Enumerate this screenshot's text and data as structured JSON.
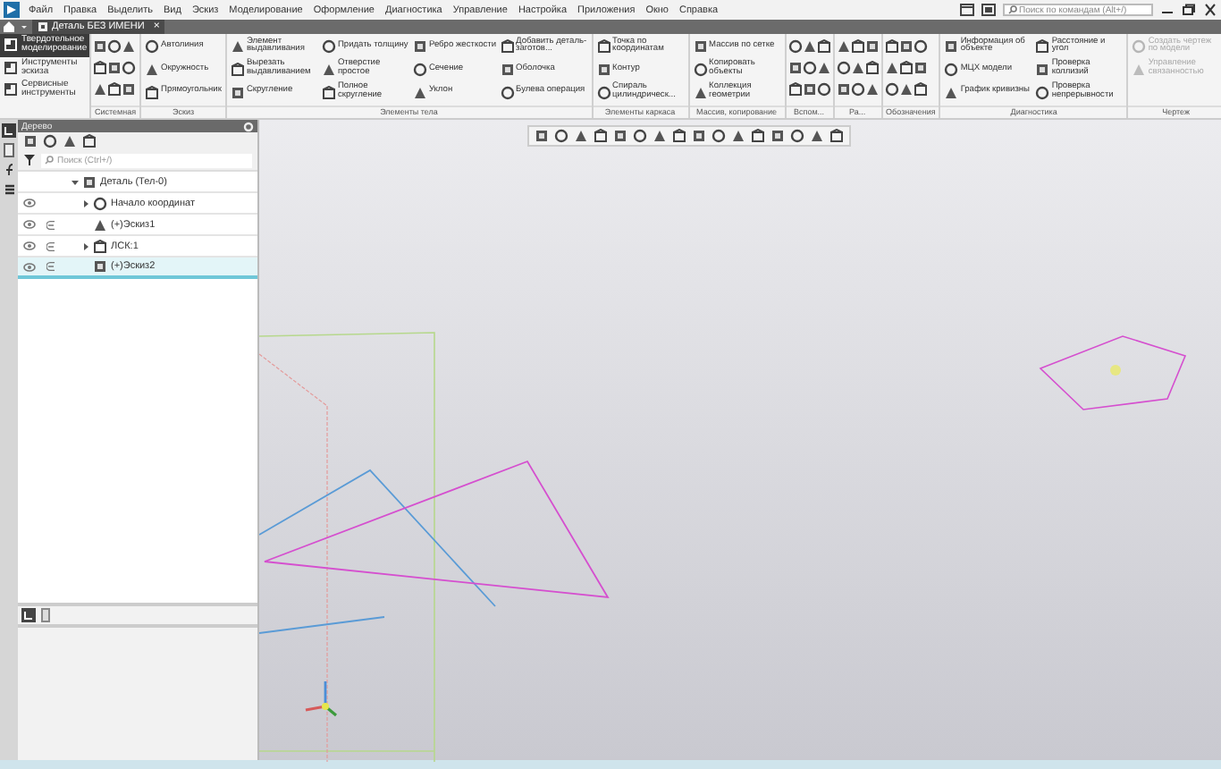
{
  "menu": {
    "items": [
      "Файл",
      "Правка",
      "Выделить",
      "Вид",
      "Эскиз",
      "Моделирование",
      "Оформление",
      "Диагностика",
      "Управление",
      "Настройка",
      "Приложения",
      "Окно",
      "Справка"
    ]
  },
  "command_search": {
    "placeholder": "Поиск по командам (Alt+/)"
  },
  "document_tabs": [
    {
      "label": "Деталь БЕЗ ИМЕНИ",
      "selected": true,
      "close": "×"
    }
  ],
  "ribbon": {
    "modes": [
      {
        "label": "Твердотельное моделирование",
        "selected": true
      },
      {
        "label": "Инструменты эскиза",
        "selected": false
      },
      {
        "label": "Сервисные инструменты",
        "selected": false
      }
    ],
    "groups": [
      {
        "label": "Системная",
        "kind": "icons"
      },
      {
        "label": "Эскиз",
        "kind": "tools",
        "items": [
          {
            "label": "Автолиния",
            "disabled": false
          },
          {
            "label": "Окружность",
            "disabled": false
          },
          {
            "label": "Прямоугольник",
            "disabled": false
          }
        ]
      },
      {
        "label": "Элементы тела",
        "kind": "tools",
        "items": [
          {
            "label": "Элемент выдавливания",
            "disabled": false
          },
          {
            "label": "Вырезать выдавливанием",
            "disabled": false
          },
          {
            "label": "Скругление",
            "disabled": false
          },
          {
            "label": "Придать толщину",
            "disabled": false
          },
          {
            "label": "Отверстие простое",
            "disabled": false
          },
          {
            "label": "Полное скругление",
            "disabled": false
          },
          {
            "label": "Ребро жесткости",
            "disabled": false
          },
          {
            "label": "Сечение",
            "disabled": false
          },
          {
            "label": "Уклон",
            "disabled": false
          },
          {
            "label": "Добавить деталь-заготов...",
            "disabled": false
          },
          {
            "label": "Оболочка",
            "disabled": false
          },
          {
            "label": "Булева операция",
            "disabled": false
          }
        ]
      },
      {
        "label": "Элементы каркаса",
        "kind": "tools",
        "items": [
          {
            "label": "Точка по координатам",
            "disabled": false
          },
          {
            "label": "Контур",
            "disabled": false
          },
          {
            "label": "Спираль цилиндрическ...",
            "disabled": false
          }
        ]
      },
      {
        "label": "Массив, копирование",
        "kind": "tools",
        "items": [
          {
            "label": "Массив по сетке",
            "disabled": false
          },
          {
            "label": "Копировать объекты",
            "disabled": false
          },
          {
            "label": "Коллекция геометрии",
            "disabled": false
          }
        ]
      },
      {
        "label": "Вспом...",
        "kind": "icons"
      },
      {
        "label": "Ра...",
        "kind": "icons"
      },
      {
        "label": "Обозначения",
        "kind": "icons"
      },
      {
        "label": "Диагностика",
        "kind": "tools",
        "items": [
          {
            "label": "Информация об объекте",
            "disabled": false
          },
          {
            "label": "МЦХ модели",
            "disabled": false
          },
          {
            "label": "График кривизны",
            "disabled": false
          },
          {
            "label": "Расстояние и угол",
            "disabled": false
          },
          {
            "label": "Проверка коллизий",
            "disabled": false
          },
          {
            "label": "Проверка непрерывности",
            "disabled": false
          }
        ]
      },
      {
        "label": "Чертеж",
        "kind": "tools",
        "items": [
          {
            "label": "Создать чертеж по модели",
            "disabled": true
          },
          {
            "label": "Управление связанностью",
            "disabled": true
          }
        ]
      }
    ]
  },
  "tree_panel": {
    "title": "Дерево",
    "search": {
      "placeholder": "Поиск (Ctrl+/)"
    },
    "items": [
      {
        "label": "Деталь (Тел-0)",
        "kind": "folder",
        "expanded": true,
        "visible": false,
        "included": false,
        "selected": false,
        "children": [
          {
            "label": "Начало координат",
            "kind": "folder",
            "expanded": false,
            "visible": true,
            "included": false,
            "selected": false
          },
          {
            "label": "(+)Эскиз1",
            "kind": "leaf",
            "visible": true,
            "included": true,
            "selected": false
          },
          {
            "label": "ЛСК:1",
            "kind": "folder",
            "expanded": false,
            "visible": true,
            "included": true,
            "selected": false
          },
          {
            "label": "(+)Эскиз2",
            "kind": "leaf",
            "visible": true,
            "included": true,
            "selected": true
          }
        ]
      }
    ]
  }
}
